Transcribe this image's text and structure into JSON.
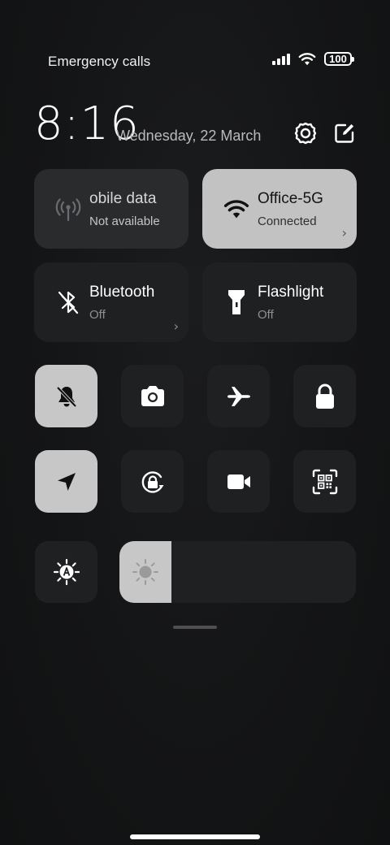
{
  "status_bar": {
    "carrier_text": "Emergency calls",
    "battery": "100",
    "signal_icon": "cellular-signal-icon",
    "wifi_icon": "wifi-icon"
  },
  "header": {
    "time": "8:16",
    "date": "Wednesday, 22 March",
    "settings_icon": "gear-icon",
    "edit_icon": "edit-icon"
  },
  "tiles_large": [
    {
      "id": "mobile-data",
      "title": "obile data",
      "subtitle": "Not available",
      "state": "disabled",
      "icon": "antenna-icon"
    },
    {
      "id": "wifi",
      "title": "Office-5G",
      "subtitle": "Connected",
      "state": "on",
      "icon": "wifi-icon"
    },
    {
      "id": "bluetooth",
      "title": "Bluetooth",
      "subtitle": "Off",
      "state": "off",
      "icon": "bluetooth-off-icon"
    },
    {
      "id": "flashlight",
      "title": "Flashlight",
      "subtitle": "Off",
      "state": "off",
      "icon": "flashlight-icon"
    }
  ],
  "tiles_small": [
    {
      "id": "silent-mode",
      "icon": "bell-off-icon",
      "state": "on"
    },
    {
      "id": "screenshot",
      "icon": "camera-icon",
      "state": "off"
    },
    {
      "id": "airplane-mode",
      "icon": "airplane-icon",
      "state": "off"
    },
    {
      "id": "lock-screen",
      "icon": "lock-icon",
      "state": "off"
    },
    {
      "id": "location",
      "icon": "location-arrow-icon",
      "state": "on"
    },
    {
      "id": "rotation-lock",
      "icon": "rotation-lock-icon",
      "state": "off"
    },
    {
      "id": "screen-recorder",
      "icon": "video-camera-icon",
      "state": "off"
    },
    {
      "id": "qr-scanner",
      "icon": "qr-scan-icon",
      "state": "off"
    }
  ],
  "brightness": {
    "auto_icon": "auto-brightness-icon",
    "slider_icon": "sun-icon",
    "level": 0.22
  },
  "colors": {
    "background": "#141516",
    "tile_off": "#1f2022",
    "tile_on": "#c7c7c7",
    "text_secondary": "#8d8f92"
  }
}
